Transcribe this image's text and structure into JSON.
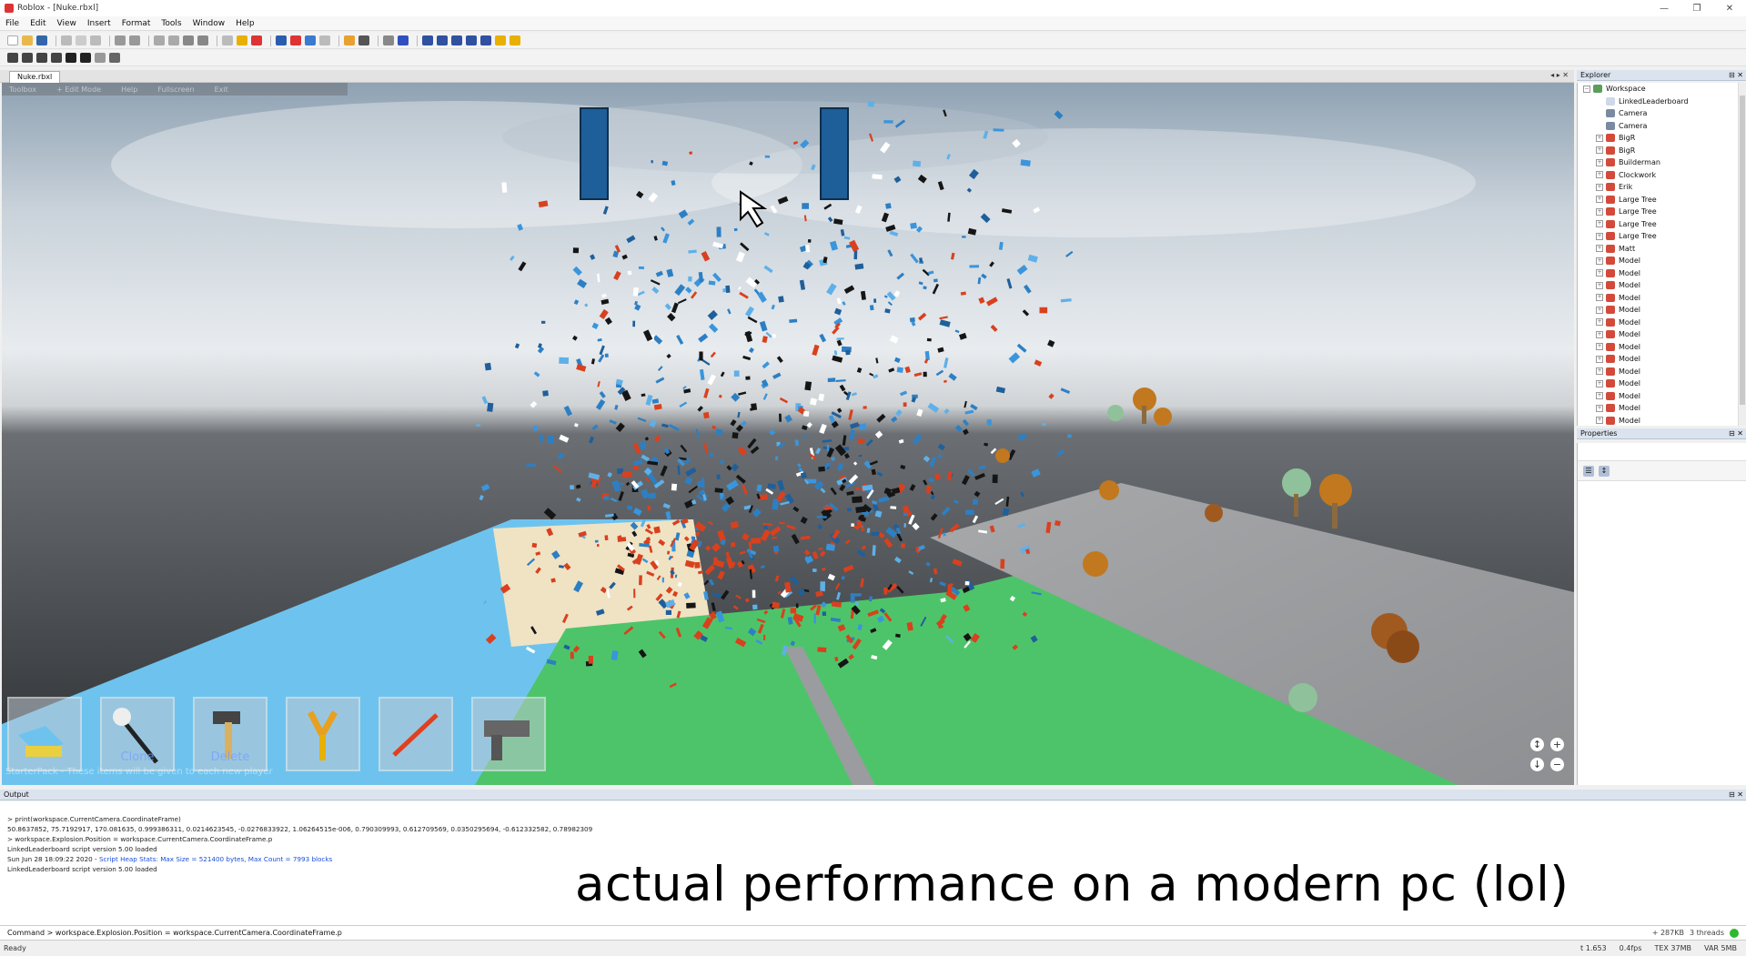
{
  "window": {
    "title": "Roblox - [Nuke.rbxl]",
    "minimize": "—",
    "restore": "❐",
    "close": "✕"
  },
  "menu": [
    "File",
    "Edit",
    "View",
    "Insert",
    "Format",
    "Tools",
    "Window",
    "Help"
  ],
  "doc_tab": "Nuke.rbxl",
  "doc_tab_arrows": "◂ ▸ ✕",
  "viewport_menu": [
    "Toolbox",
    "+ Edit Mode",
    "Help",
    "Fullscreen",
    "Exit"
  ],
  "hotbar": {
    "slots": [
      {
        "icon": "brick-tool-icon",
        "label": ""
      },
      {
        "icon": "wand-tool-icon",
        "label": "Clone"
      },
      {
        "icon": "hammer-tool-icon",
        "label": "Delete"
      },
      {
        "icon": "slingshot-tool-icon",
        "label": ""
      },
      {
        "icon": "rocket-tool-icon",
        "label": ""
      },
      {
        "icon": "blaster-tool-icon",
        "label": ""
      }
    ],
    "starterpack_text": "StarterPack - These items will be given to each new player"
  },
  "explorer": {
    "title": "Explorer",
    "items": [
      {
        "label": "Workspace",
        "icon": "workspace-icon",
        "level": 0
      },
      {
        "label": "LinkedLeaderboard",
        "icon": "script-icon",
        "level": 1
      },
      {
        "label": "Camera",
        "icon": "camera-icon",
        "level": 1
      },
      {
        "label": "Camera",
        "icon": "camera-icon",
        "level": 1
      },
      {
        "label": "BigR",
        "icon": "model-icon",
        "level": 1
      },
      {
        "label": "BigR",
        "icon": "model-icon",
        "level": 1
      },
      {
        "label": "Builderman",
        "icon": "model-icon",
        "level": 1
      },
      {
        "label": "Clockwork",
        "icon": "model-icon",
        "level": 1
      },
      {
        "label": "Erik",
        "icon": "model-icon",
        "level": 1
      },
      {
        "label": "Large Tree",
        "icon": "model-icon",
        "level": 1
      },
      {
        "label": "Large Tree",
        "icon": "model-icon",
        "level": 1
      },
      {
        "label": "Large Tree",
        "icon": "model-icon",
        "level": 1
      },
      {
        "label": "Large Tree",
        "icon": "model-icon",
        "level": 1
      },
      {
        "label": "Matt",
        "icon": "model-icon",
        "level": 1
      },
      {
        "label": "Model",
        "icon": "model-icon",
        "level": 1
      },
      {
        "label": "Model",
        "icon": "model-icon",
        "level": 1
      },
      {
        "label": "Model",
        "icon": "model-icon",
        "level": 1
      },
      {
        "label": "Model",
        "icon": "model-icon",
        "level": 1
      },
      {
        "label": "Model",
        "icon": "model-icon",
        "level": 1
      },
      {
        "label": "Model",
        "icon": "model-icon",
        "level": 1
      },
      {
        "label": "Model",
        "icon": "model-icon",
        "level": 1
      },
      {
        "label": "Model",
        "icon": "model-icon",
        "level": 1
      },
      {
        "label": "Model",
        "icon": "model-icon",
        "level": 1
      },
      {
        "label": "Model",
        "icon": "model-icon",
        "level": 1
      },
      {
        "label": "Model",
        "icon": "model-icon",
        "level": 1
      },
      {
        "label": "Model",
        "icon": "model-icon",
        "level": 1
      },
      {
        "label": "Model",
        "icon": "model-icon",
        "level": 1
      },
      {
        "label": "Model",
        "icon": "model-icon",
        "level": 1
      }
    ]
  },
  "properties": {
    "title": "Properties"
  },
  "output": {
    "title": "Output",
    "lines": [
      {
        "text": "> print(workspace.CurrentCamera.CoordinateFrame)",
        "color": "normal"
      },
      {
        "text": "50.8637852, 75.7192917, 170.081635, 0.999386311, 0.0214623545, -0.0276833922, 1.06264515e-006, 0.790309993, 0.612709569, 0.0350295694, -0.612332582, 0.78982309",
        "color": "normal"
      },
      {
        "text": "> workspace.Explosion.Position = workspace.CurrentCamera.CoordinateFrame.p",
        "color": "normal"
      },
      {
        "text": "LinkedLeaderboard script version 5.00 loaded",
        "color": "normal"
      },
      {
        "text": "Sun Jun 28 18:09:22 2020 - ",
        "color": "normal",
        "extra": "Script Heap Stats: Max Size = 521400 bytes, Max Count = 7993 blocks"
      },
      {
        "text": "LinkedLeaderboard script version 5.00 loaded",
        "color": "normal"
      }
    ]
  },
  "caption": "actual performance on a modern pc (lol)",
  "command": {
    "text": "Command >  workspace.Explosion.Position = workspace.CurrentCamera.CoordinateFrame.p",
    "memory": "+ 287KB",
    "threads": "3 threads"
  },
  "status": {
    "left": "Ready",
    "items": [
      "t 1.653",
      "0.4fps",
      "TEX 37MB",
      "VAR 5MB"
    ]
  },
  "colors": {
    "sky": "#d8dde2",
    "ground_dark": "#4a4d50",
    "grass": "#4ec46a",
    "water": "#6ec3ee",
    "tower": "#2d7fc4",
    "debris_red": "#d9401e"
  }
}
